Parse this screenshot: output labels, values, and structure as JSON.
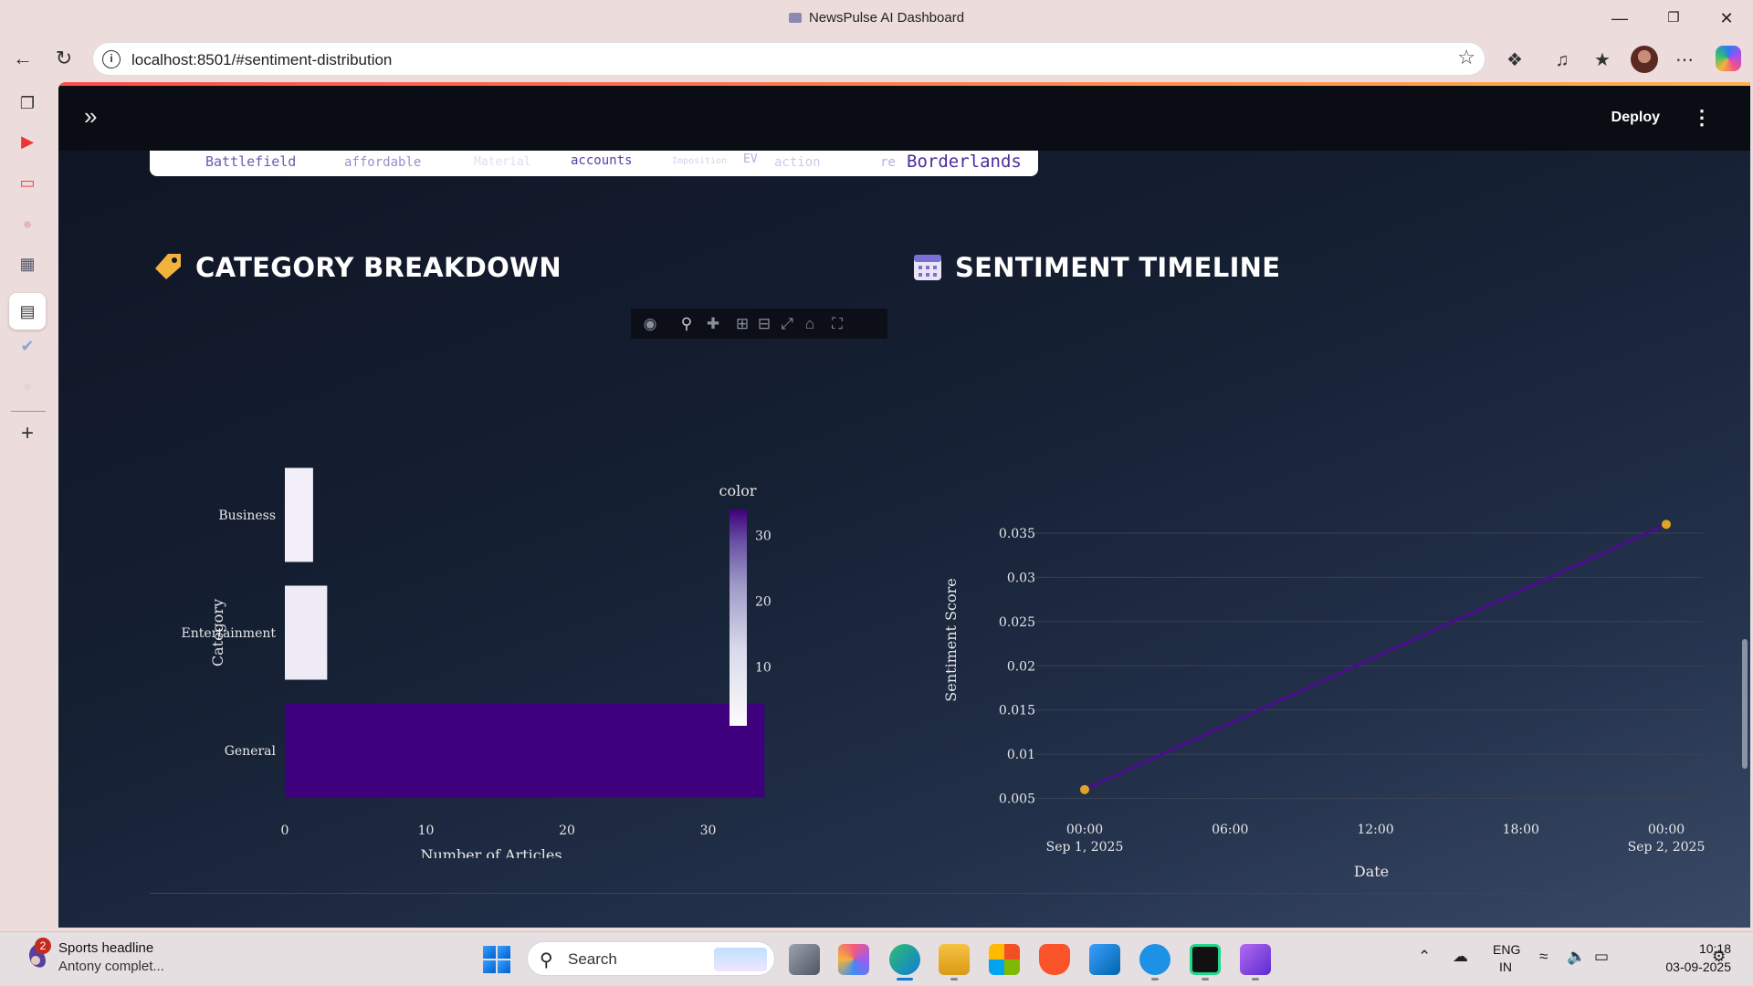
{
  "window": {
    "title": "NewsPulse AI Dashboard"
  },
  "browser": {
    "url": "localhost:8501/#sentiment-distribution"
  },
  "app": {
    "deploy_label": "Deploy"
  },
  "wordcloud": {
    "words": [
      {
        "text": "Battlefield",
        "color": "#6b5bb0"
      },
      {
        "text": "affordable",
        "color": "#9b8fcc"
      },
      {
        "text": "Material",
        "color": "#e2ddf2"
      },
      {
        "text": "accounts",
        "color": "#5a3ea8"
      },
      {
        "text": "Imposition",
        "color": "#d6d0ec"
      },
      {
        "text": "EV",
        "color": "#b7addf"
      },
      {
        "text": "action",
        "color": "#cfc8ea"
      },
      {
        "text": "re",
        "color": "#b7addf"
      },
      {
        "text": "Borderlands",
        "color": "#4a2d9c"
      }
    ]
  },
  "sections": {
    "category": {
      "title": "CATEGORY BREAKDOWN",
      "icon": "label-tag-icon"
    },
    "timeline": {
      "title": "SENTIMENT TIMELINE",
      "icon": "calendar-icon"
    }
  },
  "chart_data": [
    {
      "type": "bar",
      "orientation": "horizontal",
      "categories": [
        "Business",
        "Entertainment",
        "General"
      ],
      "values": [
        2,
        3,
        34
      ],
      "xlabel": "Number of Articles",
      "ylabel": "Category",
      "xticks": [
        "0",
        "10",
        "20",
        "30"
      ],
      "xlim": [
        0,
        34
      ],
      "colorbar": {
        "title": "color",
        "ticks": [
          "10",
          "20",
          "30"
        ],
        "low_color": "#f7f5fb",
        "high_color": "#3f007d"
      },
      "grid": false
    },
    {
      "type": "line",
      "x": [
        "2025-09-01 00:00",
        "2025-09-02 00:00"
      ],
      "y": [
        0.006,
        0.036
      ],
      "xlabel": "Date",
      "ylabel": "Sentiment Score",
      "xticks": [
        {
          "time": "00:00",
          "date": "Sep 1, 2025"
        },
        {
          "time": "06:00",
          "date": ""
        },
        {
          "time": "12:00",
          "date": ""
        },
        {
          "time": "18:00",
          "date": ""
        },
        {
          "time": "00:00",
          "date": "Sep 2, 2025"
        }
      ],
      "yticks": [
        "0.005",
        "0.01",
        "0.015",
        "0.02",
        "0.025",
        "0.03",
        "0.035"
      ],
      "line_color": "#4b0c8f",
      "marker_color": "#e0a526",
      "grid": true
    }
  ],
  "modebar": [
    "camera-icon",
    "zoom-icon",
    "pan-icon",
    "zoom-in-icon",
    "zoom-out-icon",
    "autoscale-icon",
    "reset-axes-icon",
    "fullscreen-icon"
  ],
  "taskbar": {
    "notification": {
      "badge": "2",
      "title": "Sports headline",
      "subtitle": "Antony complet..."
    },
    "search_label": "Search",
    "lang_line1": "ENG",
    "lang_line2": "IN",
    "time": "10:18",
    "date": "03-09-2025"
  }
}
